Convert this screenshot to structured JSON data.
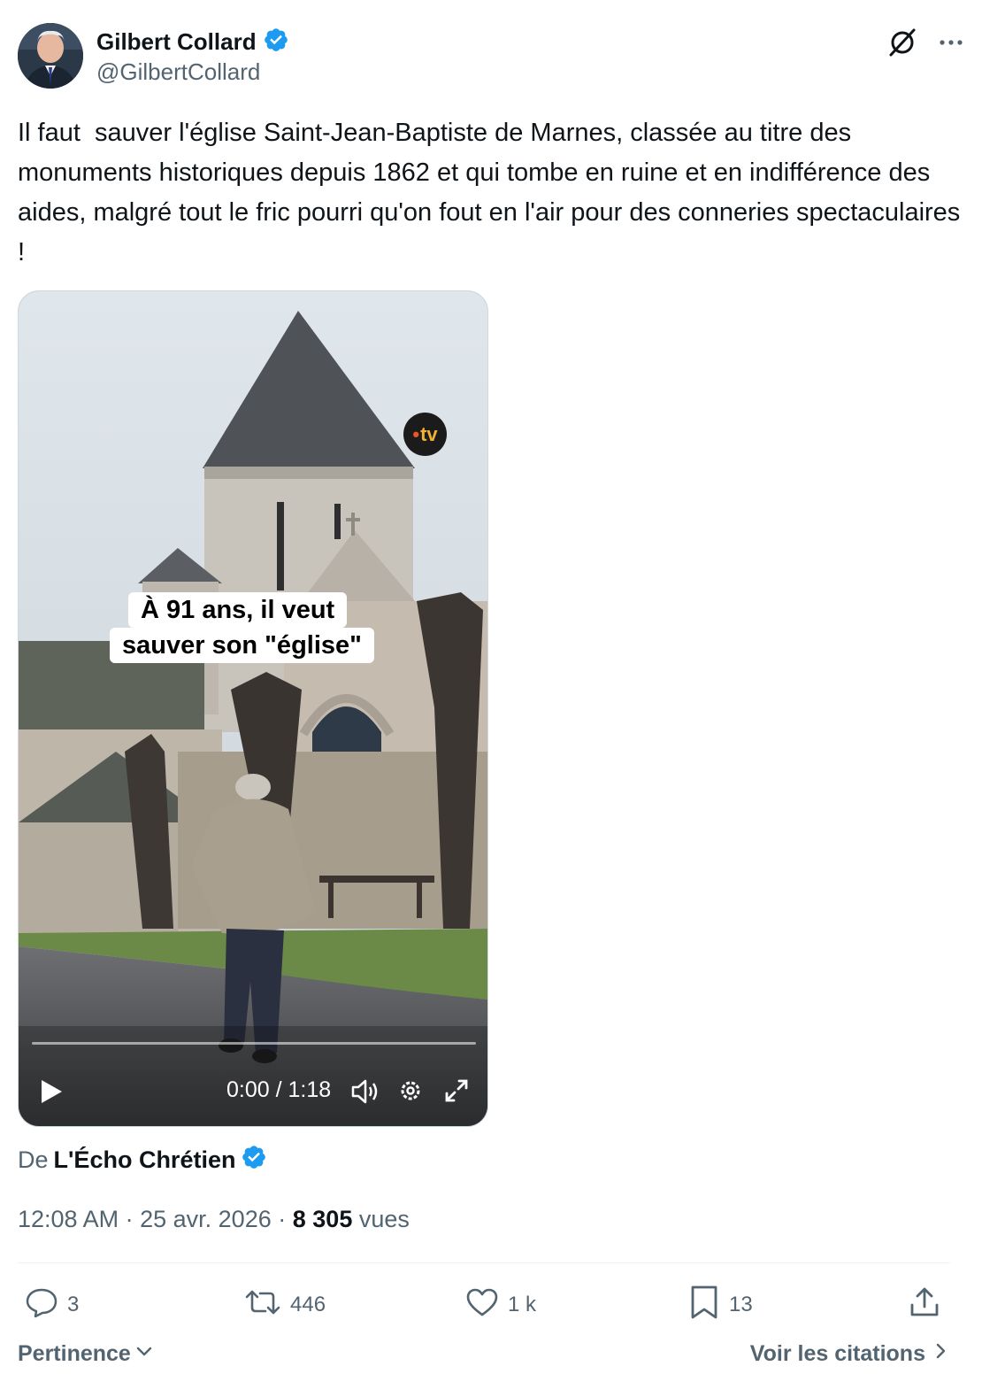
{
  "author": {
    "name": "Gilbert Collard",
    "handle": "@GilbertCollard",
    "verified_color": "#1d9bf0"
  },
  "tweet": {
    "text": "Il faut  sauver l'église Saint-Jean-Baptiste de Marnes, classée au titre des monuments historiques depuis 1862 et qui tombe en ruine et en indifférence des aides, malgré tout le fric pourri qu'on fout en l'air pour des conneries spectaculaires !"
  },
  "media": {
    "caption_line1": "À 91 ans, il veut",
    "caption_line2": "sauver son \"église\"",
    "channel_logo": "tv",
    "time": "0:00 / 1:18",
    "progress": 0
  },
  "source": {
    "prefix": "De",
    "name": "L'Écho Chrétien"
  },
  "meta": {
    "time": "12:08 AM",
    "date": "25 avr. 2026",
    "views_count": "8 305",
    "views_label": "vues",
    "separator": "·"
  },
  "actions": {
    "replies": "3",
    "reposts": "446",
    "likes": "1 k",
    "bookmarks": "13"
  },
  "footer": {
    "sort_label": "Pertinence",
    "quotes_label": "Voir les citations"
  },
  "icons": [
    "grok-icon",
    "more-icon",
    "verified-icon",
    "play-icon",
    "volume-icon",
    "settings-icon",
    "fullscreen-icon",
    "reply-icon",
    "repost-icon",
    "like-icon",
    "bookmark-icon",
    "share-icon",
    "chevron-down-icon",
    "chevron-right-icon"
  ]
}
